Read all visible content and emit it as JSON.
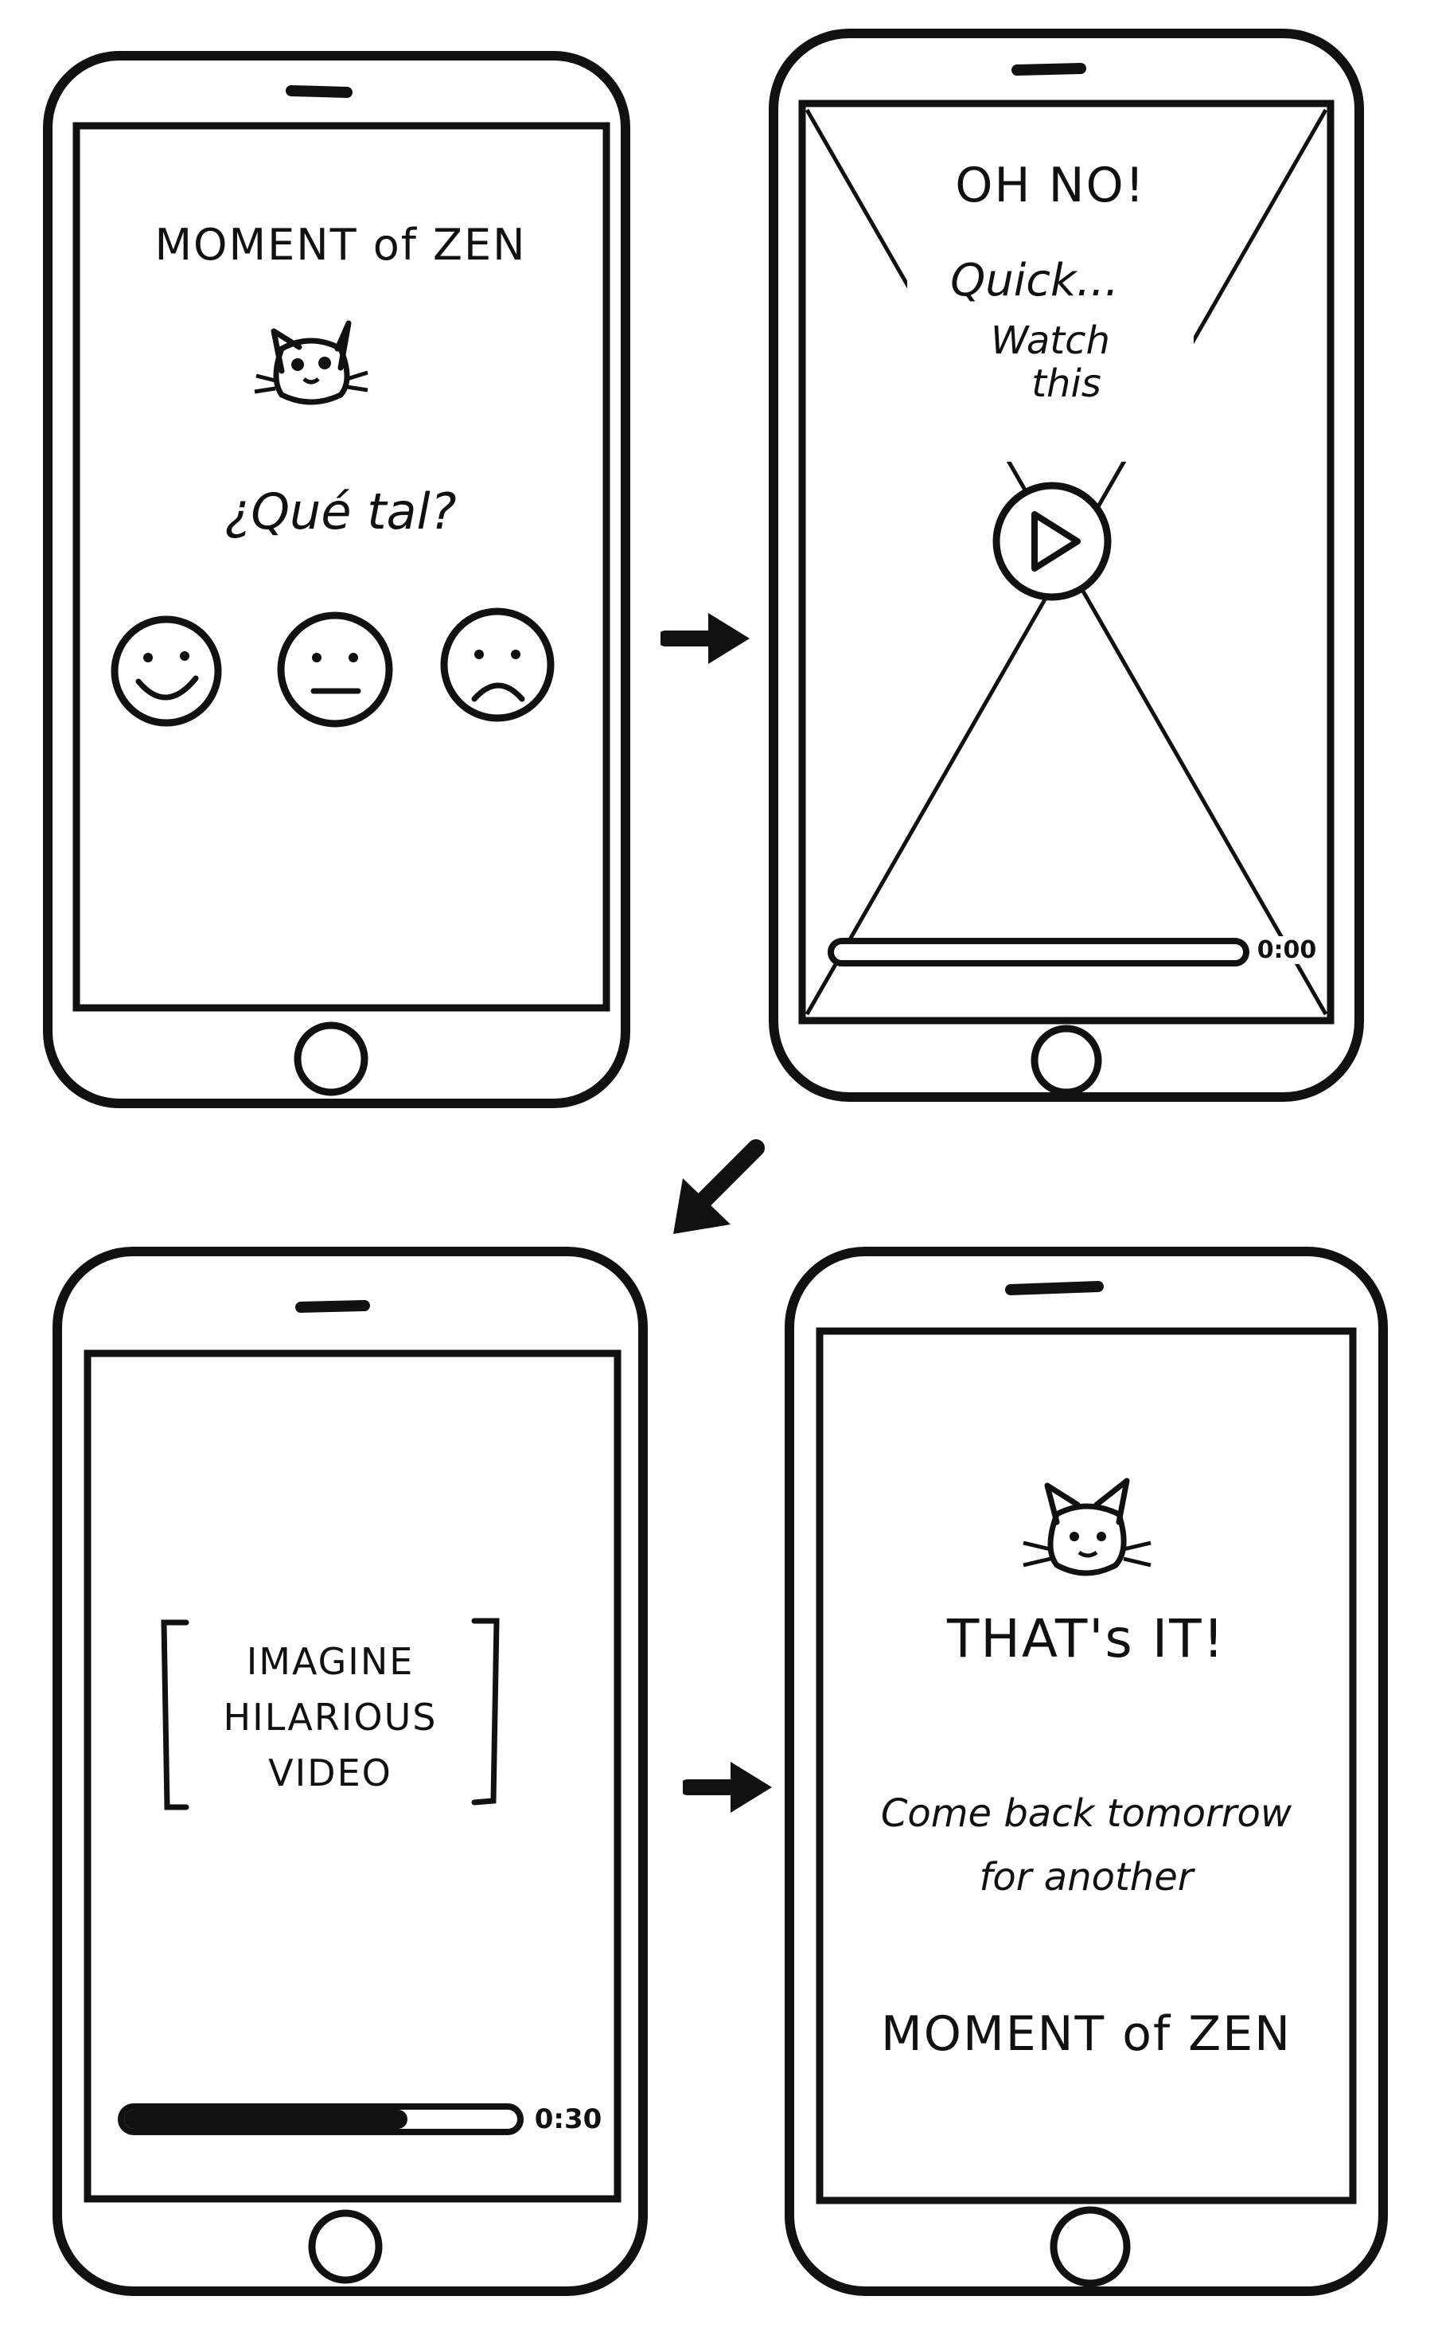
{
  "screens": {
    "s1": {
      "title": "MOMENT of ZEN",
      "question": "¿Qué tal?",
      "moods": [
        {
          "icon": "happy-face-icon"
        },
        {
          "icon": "neutral-face-icon"
        },
        {
          "icon": "sad-face-icon"
        }
      ],
      "cat_icon": "cat-face-icon"
    },
    "s2": {
      "heading": "OH NO!",
      "line1": "Quick...",
      "line2": "Watch",
      "line3": "this",
      "play_icon": "play-icon",
      "time": "0:00",
      "progress": 0
    },
    "s3": {
      "line1": "IMAGINE",
      "line2": "HILARIOUS",
      "line3": "VIDEO",
      "time": "0:30",
      "progress": 0.72
    },
    "s4": {
      "heading": "THAT's IT!",
      "line1": "Come back tomorrow",
      "line2": "for another",
      "title": "MOMENT of ZEN",
      "cat_icon": "cat-face-icon"
    }
  },
  "arrows": [
    "arrow-right-icon",
    "arrow-down-left-icon",
    "arrow-right-icon"
  ],
  "colors": {
    "ink": "#111111",
    "paper": "#ffffff"
  }
}
